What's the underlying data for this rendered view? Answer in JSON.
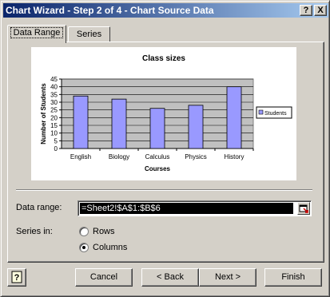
{
  "window": {
    "title": "Chart Wizard - Step 2 of 4 - Chart Source Data",
    "help_glyph": "?",
    "close_glyph": "X"
  },
  "tabs": [
    {
      "label": "Data Range",
      "active": true
    },
    {
      "label": "Series",
      "active": false
    }
  ],
  "chart_data": {
    "type": "bar",
    "title": "Class sizes",
    "xlabel": "Courses",
    "ylabel": "Number of Students",
    "categories": [
      "English",
      "Biology",
      "Calculus",
      "Physics",
      "History"
    ],
    "series": [
      {
        "name": "Students",
        "values": [
          34,
          32,
          26,
          28,
          40
        ],
        "color": "#9999ff"
      }
    ],
    "ylim": [
      0,
      45
    ],
    "yticks": [
      "0",
      "5",
      "10",
      "15",
      "20",
      "25",
      "30",
      "35",
      "40",
      "45"
    ],
    "grid": true,
    "plot_background": "#c0c0c0",
    "legend_position": "right"
  },
  "data_range": {
    "label": "Data range:",
    "value": "=Sheet2!$A$1:$B$6"
  },
  "series_in": {
    "label": "Series in:",
    "options": [
      {
        "label": "Rows",
        "selected": false
      },
      {
        "label": "Columns",
        "selected": true
      }
    ]
  },
  "buttons": {
    "cancel": "Cancel",
    "back": "< Back",
    "next": "Next >",
    "finish": "Finish"
  }
}
